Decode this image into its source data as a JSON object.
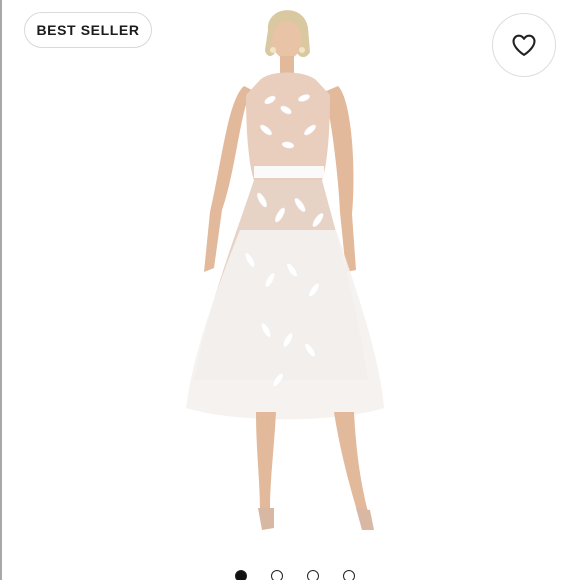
{
  "badge": {
    "label": "BEST SELLER"
  },
  "favorite": {
    "icon": "heart-outline-icon"
  },
  "gallery": {
    "image": "white-embroidered-lace-midi-dress-product-photo",
    "total_images": 4,
    "active_index": 0
  },
  "colors": {
    "dot_active": "#111111",
    "border": "#d9d9d9"
  }
}
